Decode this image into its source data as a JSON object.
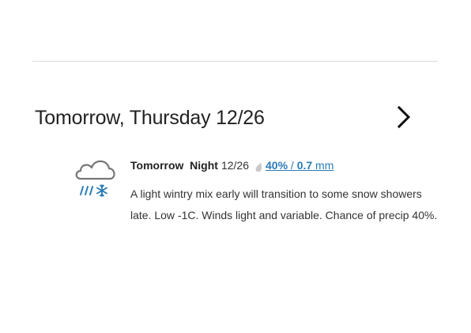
{
  "forecast": {
    "day_title": "Tomorrow, Thursday 12/26",
    "next_icon": "chevron-right-icon",
    "period": {
      "icon": "rain-snow-mix-icon",
      "name": "Tomorrow  Night",
      "date": "12/26",
      "precip_icon": "raindrop-icon",
      "precip_percent": "40%",
      "precip_separator": " / ",
      "precip_amount": "0.7",
      "precip_unit": " mm",
      "description": "A light wintry mix early will transition to some snow showers late. Low -1C. Winds light and variable. Chance of precip 40%."
    }
  },
  "colors": {
    "link": "#2a7bb8",
    "divider": "#dcdcdc",
    "icon_blue": "#2a7bb8",
    "cloud_outline": "#777777"
  }
}
